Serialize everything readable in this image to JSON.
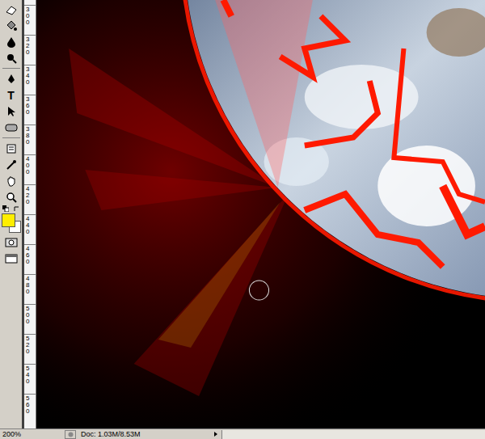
{
  "toolbar": {
    "type_tool": "T",
    "foreground_color": "#ffee00",
    "background_color": "#ffffff"
  },
  "ruler": {
    "labels": [
      "300",
      "320",
      "340",
      "360",
      "380",
      "400",
      "420",
      "440",
      "460",
      "480",
      "500",
      "520",
      "540",
      "560"
    ]
  },
  "status_bar": {
    "zoom": "200%",
    "doc": "Doc: 1.03M/8.53M"
  }
}
